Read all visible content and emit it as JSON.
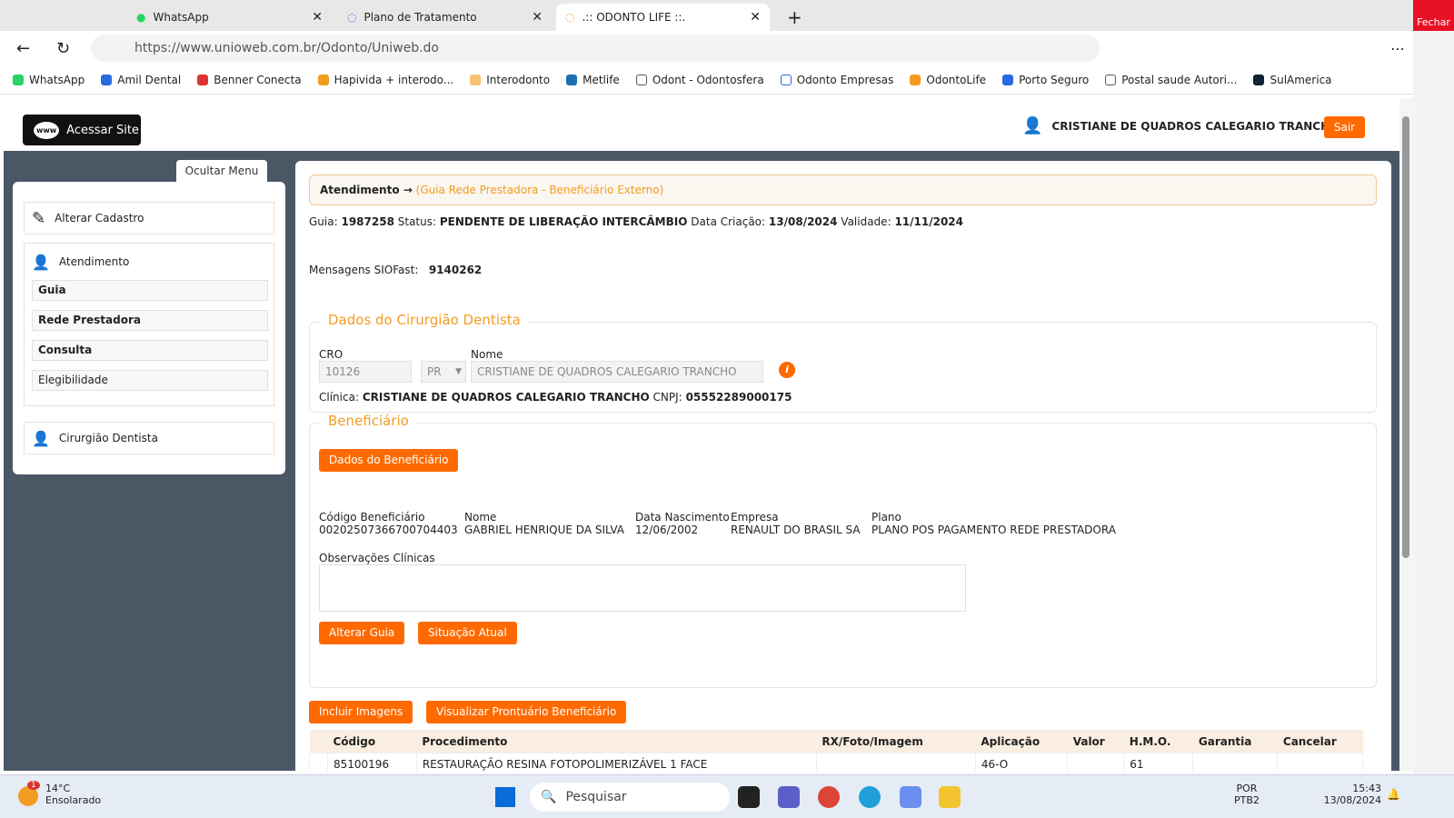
{
  "browser": {
    "tabs": [
      {
        "label": "WhatsApp"
      },
      {
        "label": "Plano de Tratamento"
      },
      {
        "label": ".:: ODONTO LIFE ::."
      }
    ],
    "url": "https://www.unioweb.com.br/Odonto/Uniweb.do",
    "close_tooltip": "Fechar",
    "bookmarks": [
      "WhatsApp",
      "Amil Dental",
      "Benner Conecta",
      "Hapivida + interodo...",
      "Interodonto",
      "Metlife",
      "Odont - Odontosfera",
      "Odonto Empresas",
      "OdontoLife",
      "Porto Seguro",
      "Postal saude Autori...",
      "SulAmerica"
    ]
  },
  "header": {
    "site_button": "Acessar Site",
    "site_icon": "www",
    "user": "CRISTIANE DE QUADROS CALEGARIO TRANCHO",
    "logout": "Sair"
  },
  "menu": {
    "hide": "Ocultar Menu",
    "alterar": "Alterar Cadastro",
    "atendimento": "Atendimento",
    "subitems": [
      "Guia",
      "Rede Prestadora",
      "Consulta",
      "Elegibilidade"
    ],
    "cirurgiao": "Cirurgião Dentista"
  },
  "main": {
    "crumb_root": "Atendimento →",
    "crumb_sub": "(Guia Rede Prestadora - Beneficiário Externo)",
    "guia_label": "Guia:",
    "guia": "1987258",
    "status_label": "Status:",
    "status": "PENDENTE DE LIBERAÇÃO INTERCÂMBIO",
    "criacao_label": "Data Criação:",
    "criacao": "13/08/2024",
    "validade_label": "Validade:",
    "validade": "11/11/2024",
    "msg_label": "Mensagens SIOFast:",
    "msg": "9140262",
    "dentista": {
      "legend": "Dados do Cirurgião Dentista",
      "cro_label": "CRO",
      "cro": "10126",
      "uf": "PR",
      "nome_label": "Nome",
      "nome": "CRISTIANE DE QUADROS CALEGARIO TRANCHO",
      "clinica_label": "Clínica:",
      "clinica": "CRISTIANE DE QUADROS CALEGARIO TRANCHO",
      "cnpj_label": "CNPJ:",
      "cnpj": "05552289000175"
    },
    "beneficiario": {
      "legend": "Beneficiário",
      "dados_btn": "Dados do Beneficiário",
      "fields": [
        {
          "label": "Código Beneficiário",
          "value": "00202507366700704403"
        },
        {
          "label": "Nome",
          "value": "GABRIEL HENRIQUE DA SILVA"
        },
        {
          "label": "Data Nascimento",
          "value": "12/06/2002"
        },
        {
          "label": "Empresa",
          "value": "RENAULT DO BRASIL SA"
        },
        {
          "label": "Plano",
          "value": "PLANO POS PAGAMENTO REDE PRESTADORA"
        }
      ],
      "obs_label": "Observações Clínicas",
      "obs": "",
      "alterar_btn": "Alterar Guia",
      "situacao_btn": "Situação Atual"
    },
    "incluir_btn": "Incluir Imagens",
    "prontuario_btn": "Visualizar Prontuário Beneficiário",
    "table": {
      "headers": [
        "Código",
        "Procedimento",
        "RX/Foto/Imagem",
        "Aplicação",
        "Valor",
        "H.M.O.",
        "Garantia",
        "Cancelar"
      ],
      "rows": [
        [
          "85100196",
          "RESTAURAÇÃO RESINA FOTOPOLIMERIZÁVEL 1 FACE",
          "",
          "46-O",
          "",
          "61",
          "",
          ""
        ]
      ]
    }
  },
  "taskbar": {
    "temp": "14°C",
    "weather": "Ensolarado",
    "badge": "1",
    "search": "Pesquisar",
    "lang": "POR",
    "layout": "PTB2",
    "time": "15:43",
    "date": "13/08/2024"
  },
  "colors": {
    "accent": "#ff6a00",
    "legend": "#f39c22",
    "page_bg": "#4a5866"
  }
}
